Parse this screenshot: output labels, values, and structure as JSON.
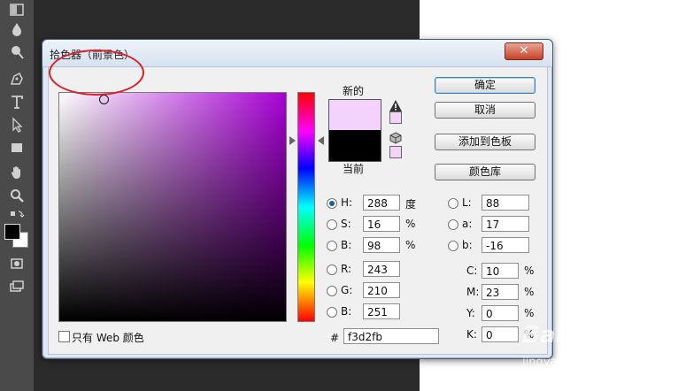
{
  "dialog": {
    "title": "拾色器（前景色）",
    "close_glyph": "✕"
  },
  "swatches": {
    "new_label": "新的",
    "current_label": "当前",
    "new_color": "#f3d2fb",
    "current_color": "#000000"
  },
  "buttons": {
    "ok": "确定",
    "cancel": "取消",
    "add_to_swatches": "添加到色板",
    "color_libraries": "颜色库"
  },
  "hsb": {
    "h": {
      "label": "H:",
      "value": "288",
      "unit": "度"
    },
    "s": {
      "label": "S:",
      "value": "16",
      "unit": "%"
    },
    "b": {
      "label": "B:",
      "value": "98",
      "unit": "%"
    }
  },
  "rgb": {
    "r": {
      "label": "R:",
      "value": "243"
    },
    "g": {
      "label": "G:",
      "value": "210"
    },
    "b": {
      "label": "B:",
      "value": "251"
    }
  },
  "lab": {
    "l": {
      "label": "L:",
      "value": "88"
    },
    "a": {
      "label": "a:",
      "value": "17"
    },
    "b": {
      "label": "b:",
      "value": "-16"
    }
  },
  "cmyk": {
    "c": {
      "label": "C:",
      "value": "10",
      "unit": "%"
    },
    "m": {
      "label": "M:",
      "value": "23",
      "unit": "%"
    },
    "y": {
      "label": "Y:",
      "value": "0",
      "unit": "%"
    },
    "k": {
      "label": "K:",
      "value": "0",
      "unit": "%"
    }
  },
  "hex": {
    "label": "#",
    "value": "f3d2fb"
  },
  "web_only": {
    "label": "只有 Web 颜色"
  },
  "watermark": {
    "brand": "Bai",
    "brand_suffix": "经验",
    "url": "jingyan.baidu.com"
  },
  "icons": [
    "gradient-icon",
    "blur-drop-icon",
    "dodge-icon",
    "pen-icon",
    "type-icon",
    "path-select-icon",
    "rectangle-icon",
    "hand-icon",
    "zoom-icon",
    "swap-colors-icon",
    "quick-mask-icon",
    "screen-mode-icon",
    "warning-icon",
    "web-cube-icon"
  ]
}
